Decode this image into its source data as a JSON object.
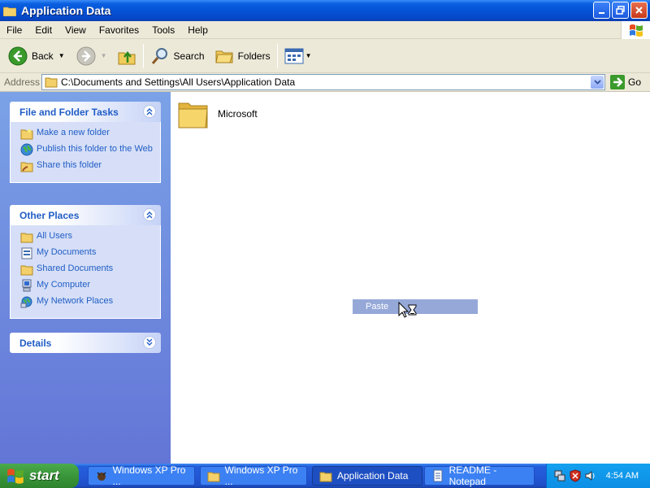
{
  "window": {
    "title": "Application Data"
  },
  "menu": [
    "File",
    "Edit",
    "View",
    "Favorites",
    "Tools",
    "Help"
  ],
  "toolbar": {
    "back": "Back",
    "search": "Search",
    "folders": "Folders"
  },
  "address": {
    "label": "Address",
    "path": "C:\\Documents and Settings\\All Users\\Application Data",
    "go": "Go"
  },
  "tasks_panel": {
    "title": "File and Folder Tasks",
    "items": [
      "Make a new folder",
      "Publish this folder to the Web",
      "Share this folder"
    ]
  },
  "places_panel": {
    "title": "Other Places",
    "items": [
      "All Users",
      "My Documents",
      "Shared Documents",
      "My Computer",
      "My Network Places"
    ]
  },
  "details_panel": {
    "title": "Details"
  },
  "content": {
    "folders": [
      "Microsoft"
    ],
    "context_item": "Paste"
  },
  "taskbar": {
    "start": "start",
    "buttons": [
      "Windows XP Pro ...",
      "Windows XP Pro ...",
      "Application Data",
      "README - Notepad"
    ],
    "clock": "4:54 AM"
  },
  "colors": {
    "link": "#215dc6",
    "titlebar": "#0553d6",
    "leftpane": "#7ba2e7",
    "start": "#3a963a"
  }
}
